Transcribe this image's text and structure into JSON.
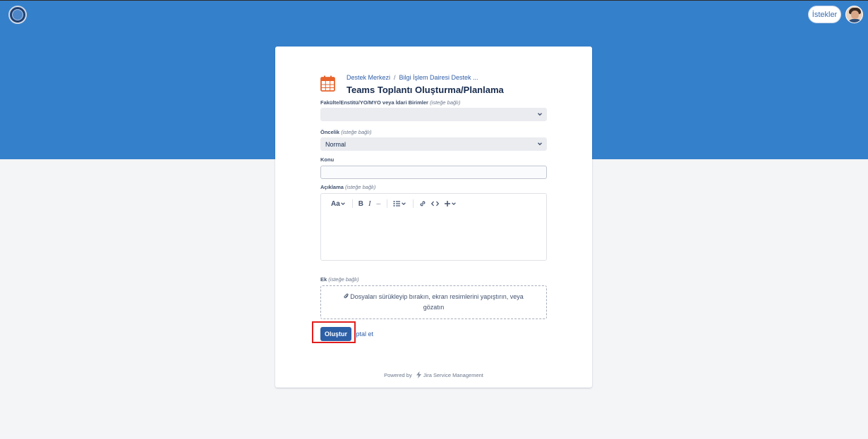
{
  "header": {
    "requests_label": "İstekler"
  },
  "breadcrumb": {
    "items": [
      "Destek Merkezi",
      "Bilgi İşlem Dairesi Destek ..."
    ],
    "separator": "/"
  },
  "page": {
    "title": "Teams Toplantı Oluşturma/Planlama"
  },
  "form": {
    "optional_text": "(isteğe bağlı)",
    "unit": {
      "label": "Fakülte/Enstitü/YO/MYO veya İdari Birimler",
      "value": ""
    },
    "priority": {
      "label": "Öncelik",
      "value": "Normal"
    },
    "subject": {
      "label": "Konu",
      "value": ""
    },
    "description": {
      "label": "Açıklama",
      "toolbar": {
        "text_style": "Aa",
        "bold": "B",
        "italic": "I",
        "more": "···"
      }
    },
    "attachment": {
      "label": "Ek",
      "dropzone_text": "Dosyaları sürükleyip bırakın, ekran resimlerini yapıştırın, veya gözatın"
    },
    "create_label": "Oluştur",
    "cancel_label": "İptal et"
  },
  "footer": {
    "powered_by": "Powered by",
    "product": "Jira Service Management"
  },
  "colors": {
    "banner": "#3580cb",
    "primary_button": "#2d5fa6",
    "link": "#2f5ea8",
    "highlight": "#e11d1d",
    "calendar_icon": "#e8642c"
  },
  "icons": {
    "logo": "portal-logo-icon",
    "calendar": "calendar-icon",
    "chevron": "chevron-down-icon",
    "attachment": "paperclip-icon",
    "jira": "jira-bolt-icon"
  }
}
